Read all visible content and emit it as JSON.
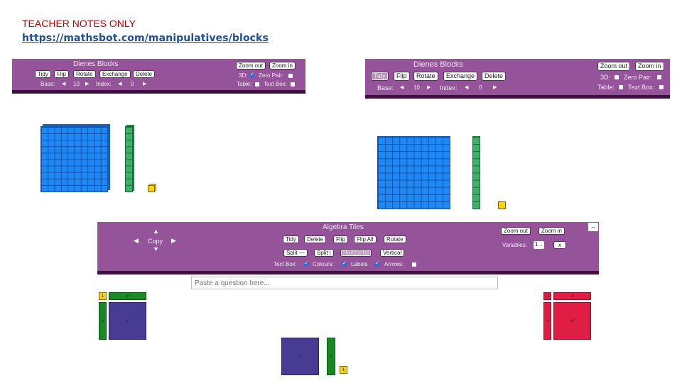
{
  "notes": {
    "title": "TEACHER NOTES ONLY",
    "link": "https://mathsbot.com/manipulatives/blocks"
  },
  "dienes_left": {
    "title": "Dienes Blocks",
    "buttons": [
      "Tidy",
      "Flip",
      "Rotate",
      "Exchange",
      "Delete"
    ],
    "zoom_out": "Zoom out",
    "zoom_in": "Zoom in",
    "base_label": "Base:",
    "base_value": "10",
    "index_label": "Index:",
    "index_value": "0",
    "options": [
      {
        "label": "3D:",
        "checked": true
      },
      {
        "label": "Zero Pair:",
        "checked": false
      },
      {
        "label": "Table:",
        "checked": false
      },
      {
        "label": "Text Box:",
        "checked": false
      }
    ]
  },
  "dienes_right": {
    "title": "Dienes Blocks",
    "buttons": [
      "Tidy",
      "Flip",
      "Rotate",
      "Exchange",
      "Delete"
    ],
    "tidy_disabled": true,
    "zoom_out": "Zoom out",
    "zoom_in": "Zoom in",
    "base_label": "Base:",
    "base_value": "10",
    "index_label": "Index:",
    "index_value": "0",
    "options": [
      {
        "label": "3D:",
        "checked": false
      },
      {
        "label": "Zero Pair:",
        "checked": false
      },
      {
        "label": "Table:",
        "checked": false
      },
      {
        "label": "Text Box:",
        "checked": false
      }
    ]
  },
  "algebra": {
    "title": "Algebra Tiles",
    "copy_label": "Copy",
    "row1": [
      "Tidy",
      "Delete",
      "Flip",
      "Flip All",
      "Rotate"
    ],
    "row2": [
      "Split —",
      "Split |",
      "Horizontal",
      "Vertical"
    ],
    "horizontal_disabled": true,
    "options": [
      {
        "label": "Text Box:",
        "checked": true
      },
      {
        "label": "Colours:",
        "checked": true
      },
      {
        "label": "Labels",
        "checked": true
      },
      {
        "label": "Arrows:",
        "checked": false
      }
    ],
    "zoom_out": "Zoom out",
    "zoom_in": "Zoom in",
    "variables_label": "Variables:",
    "variables_value": "1",
    "x_button": "x",
    "expand_icon": "↔",
    "question_placeholder": "Paste a question here..."
  },
  "tiles": {
    "x2": "x²",
    "x": "x",
    "one": "1",
    "neg_x2": "-x²",
    "neg_x": "-x",
    "neg_one": "-1"
  }
}
